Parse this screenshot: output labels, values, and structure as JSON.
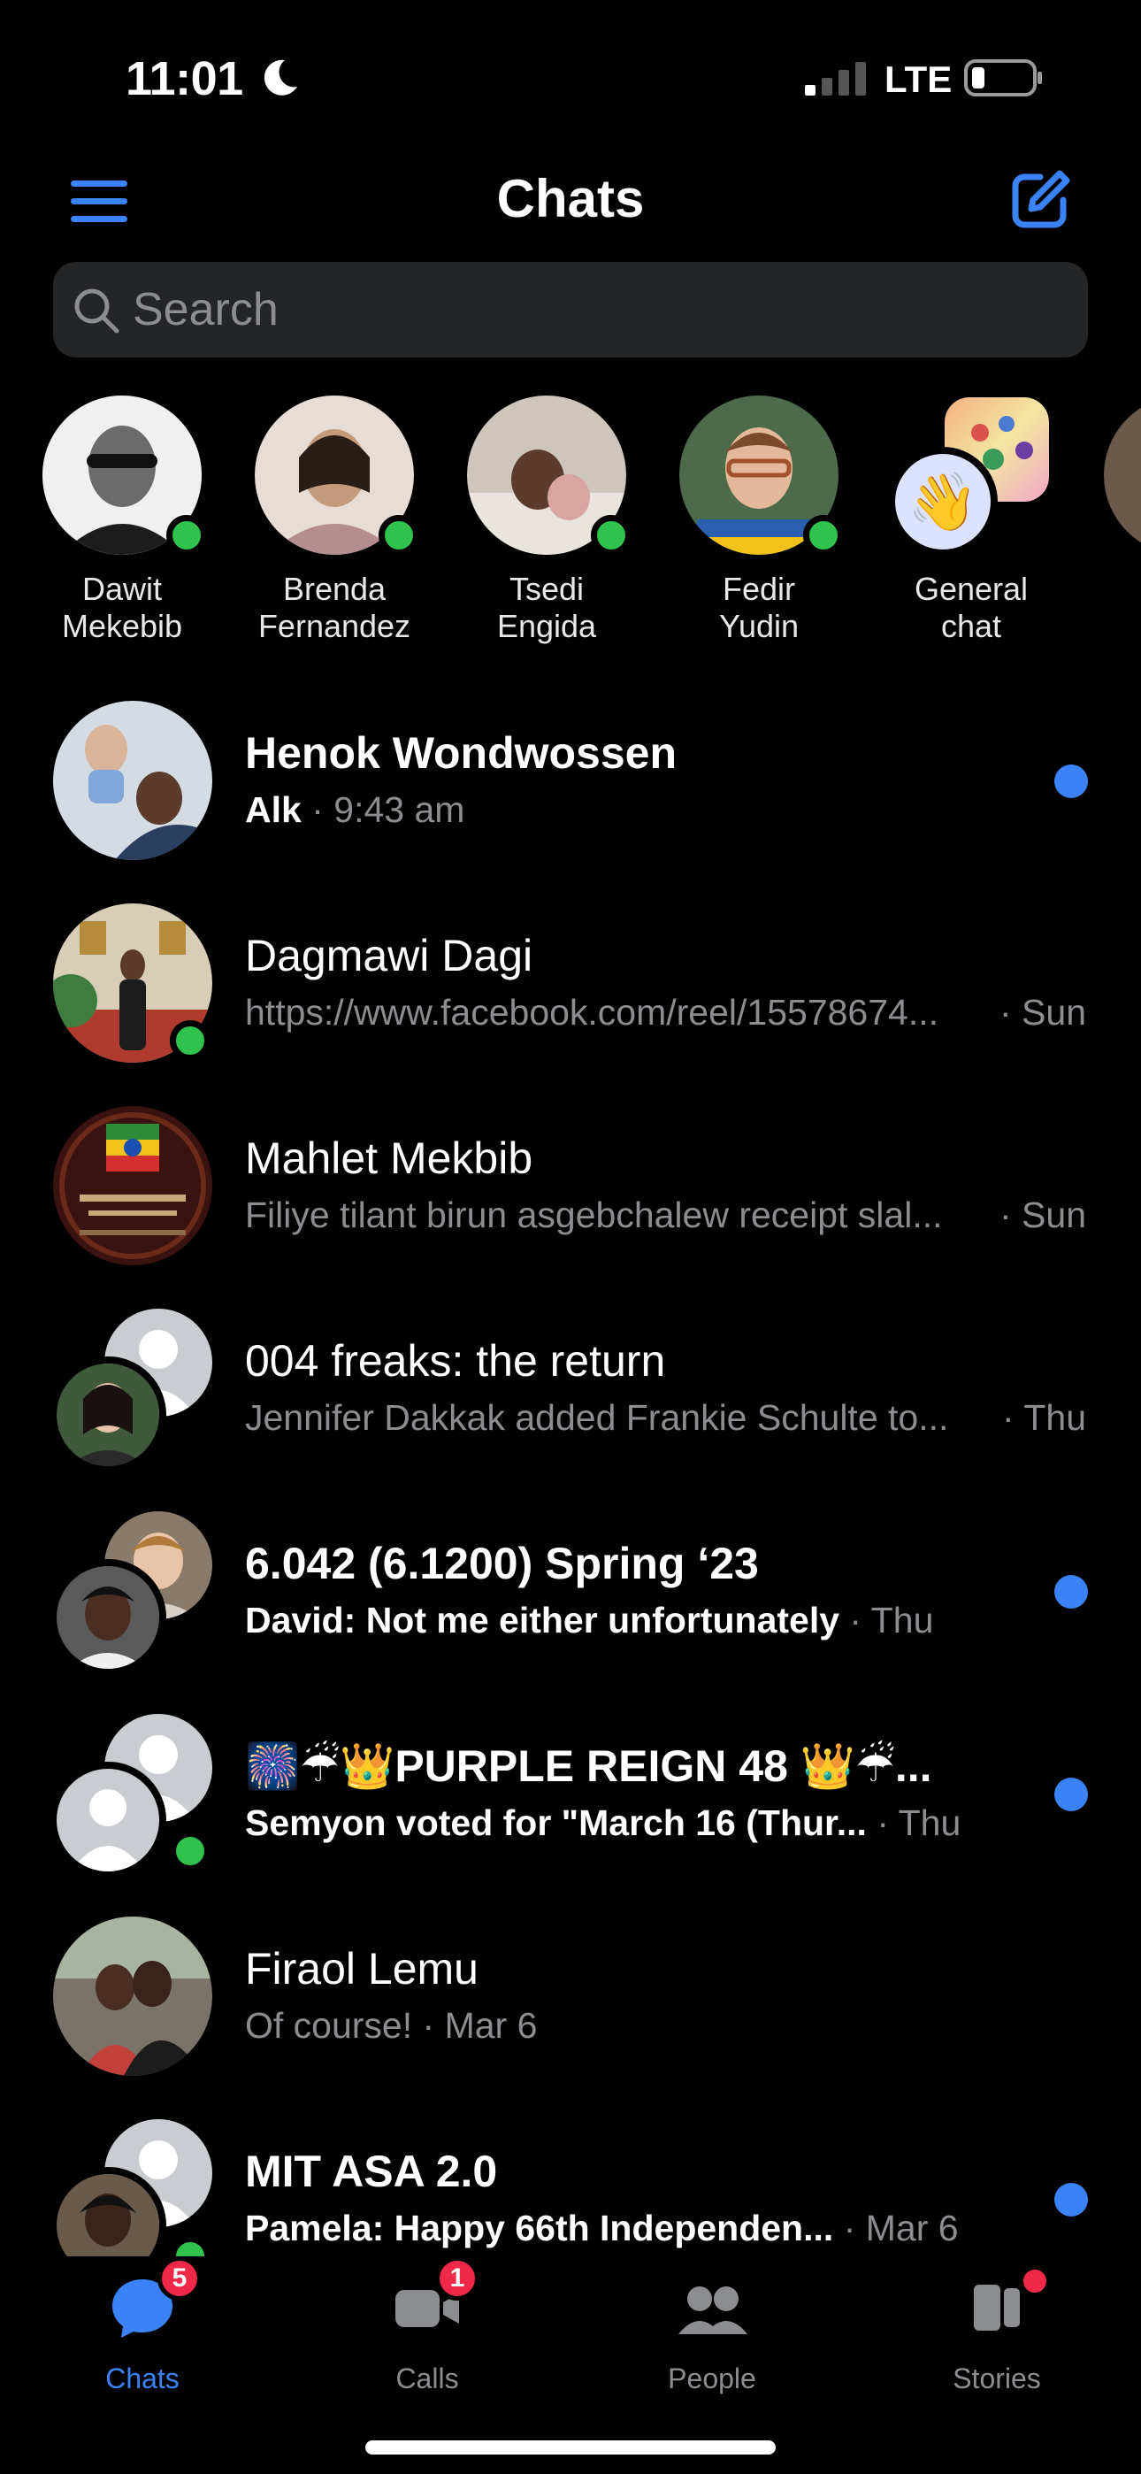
{
  "status_bar": {
    "time": "11:01",
    "network": "LTE"
  },
  "header": {
    "title": "Chats"
  },
  "search": {
    "placeholder": "Search"
  },
  "stories": [
    {
      "name": "Dawit Mekebib"
    },
    {
      "name": "Brenda Fernandez"
    },
    {
      "name": "Tsedi Engida"
    },
    {
      "name": "Fedir Yudin"
    },
    {
      "name": "General chat"
    }
  ],
  "chats": [
    {
      "title": "Henok Wondwossen",
      "snippet": "Alk",
      "time": "· 9:43 am",
      "unread": true
    },
    {
      "title": "Dagmawi Dagi",
      "snippet": "https://www.facebook.com/reel/15578674...",
      "time": "· Sun",
      "unread": false
    },
    {
      "title": "Mahlet Mekbib",
      "snippet": "Filiye tilant birun asgebchalew receipt slal...",
      "time": "· Sun",
      "unread": false
    },
    {
      "title": "004 freaks: the return",
      "snippet": "Jennifer Dakkak added Frankie Schulte to...",
      "time": "· Thu",
      "unread": false
    },
    {
      "title": "6.042 (6.1200) Spring ‘23",
      "snippet": "David: Not me either unfortunately",
      "time": "· Thu",
      "unread": true
    },
    {
      "title": "🎆☔👑PURPLE REIGN 48 👑☔...",
      "snippet": "Semyon voted for \"March 16 (Thur...",
      "time": "· Thu",
      "unread": true
    },
    {
      "title": "Firaol Lemu",
      "snippet": "Of course!",
      "time": "· Mar 6",
      "unread": false
    },
    {
      "title": "MIT ASA 2.0",
      "snippet": "Pamela: Happy 66th Independen...",
      "time": "· Mar 6",
      "unread": true
    }
  ],
  "tabs": [
    {
      "label": "Chats",
      "badge": "5",
      "active": true
    },
    {
      "label": "Calls",
      "badge": "1",
      "active": false
    },
    {
      "label": "People",
      "badge": "",
      "active": false
    },
    {
      "label": "Stories",
      "badge": "",
      "active": false
    }
  ],
  "colors": {
    "accent": "#3b82f6",
    "online": "#31c24d",
    "badge": "#f0284a",
    "search_bg": "#242526",
    "muted": "#8b8d91"
  }
}
